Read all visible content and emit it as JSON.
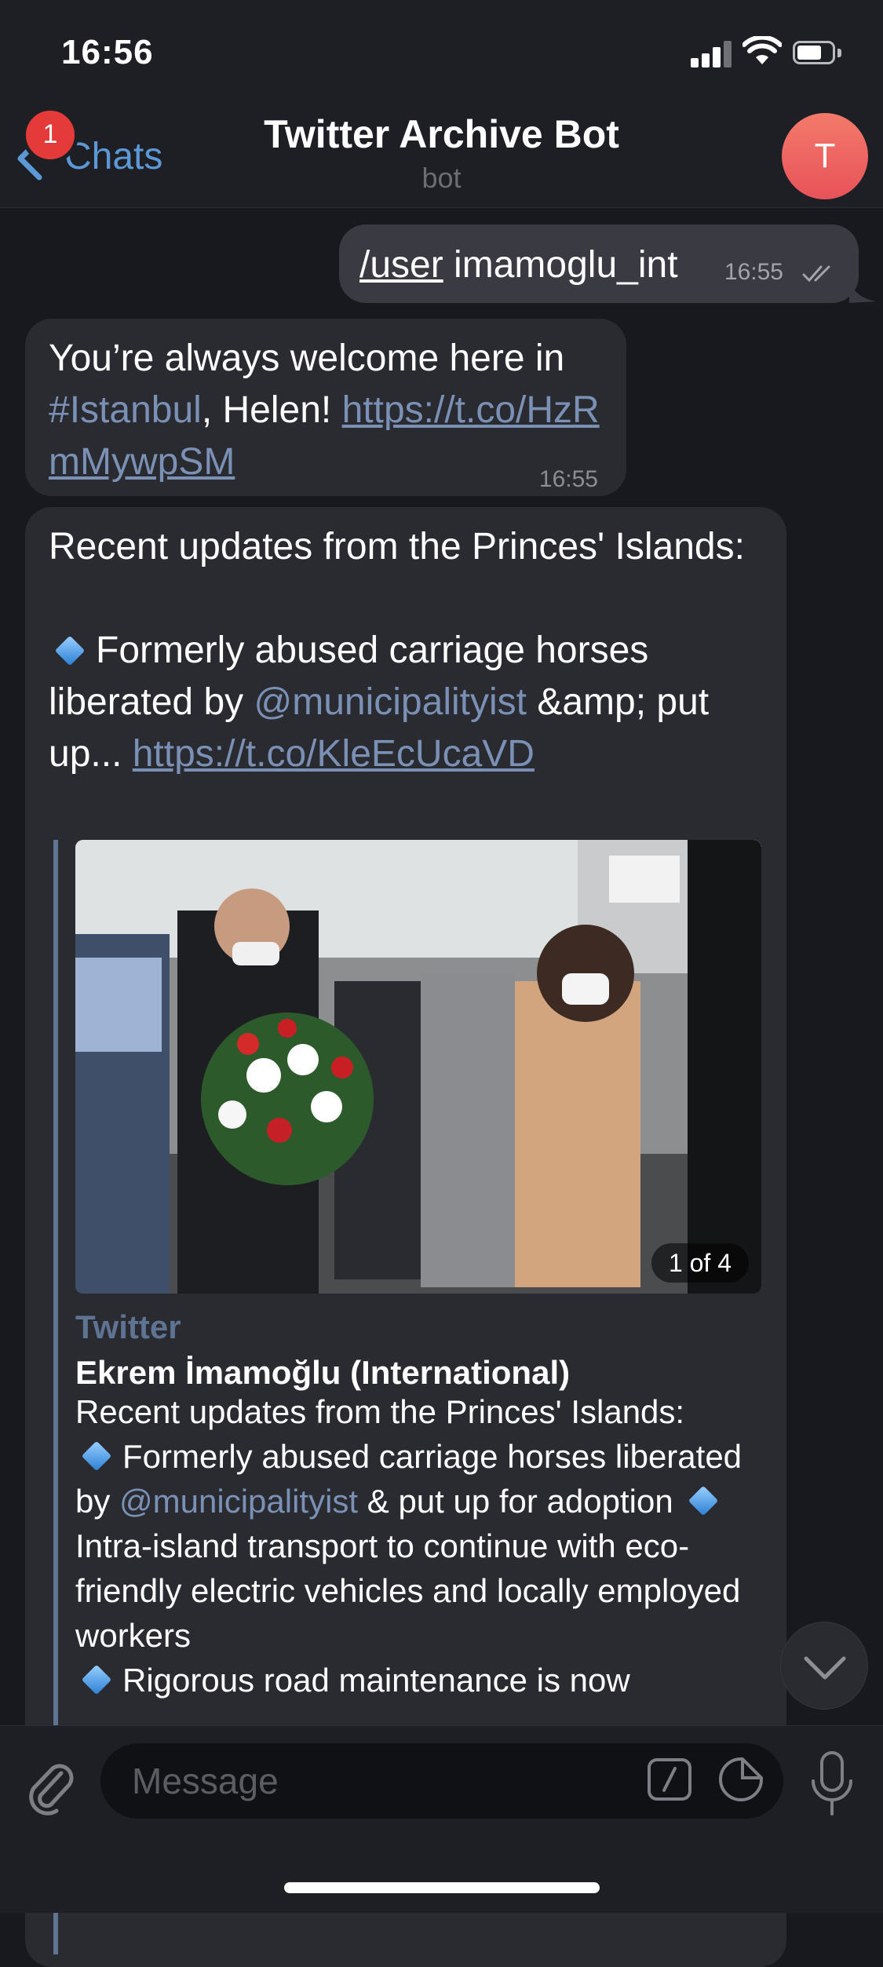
{
  "status_bar": {
    "time": "16:56"
  },
  "header": {
    "back_label": "Chats",
    "unread_badge": "1",
    "title": "Twitter Archive Bot",
    "subtitle": "bot",
    "avatar_letter": "T"
  },
  "messages": {
    "outgoing": {
      "command": "/user",
      "text": " imamoglu_int",
      "time": "16:55"
    },
    "incoming_1": {
      "text_a": "You’re always welcome here in ",
      "hashtag": "#Istanbul",
      "text_b": ", Helen! ",
      "link": "https://t.co/HzRmMywpSM",
      "time": "16:55"
    },
    "incoming_2": {
      "line1": "Recent updates from the Princes' Islands:",
      "bullet_text_a": "Formerly abused carriage horses liberated by ",
      "mention": "@municipalityist",
      "bullet_text_b": " &amp; put up... ",
      "link": "https://t.co/KleEcUcaVD",
      "preview": {
        "photo_counter": "1 of 4",
        "site": "Twitter",
        "title": "Ekrem İmamoğlu (International)",
        "line1": "Recent updates from the Princes' Islands:",
        "b1_a": "Formerly abused carriage horses liberated by ",
        "b1_mention": "@municipalityist",
        "b1_b": " & put up for adoption",
        "b2": "Intra-island transport to continue with eco-friendly electric vehicles and locally employed workers",
        "b3": "Rigorous road maintenance is now"
      }
    }
  },
  "input": {
    "placeholder": "Message"
  },
  "colors": {
    "accent": "#5c98d6",
    "link": "#7a90b5",
    "badge": "#e53a3a",
    "avatar": "#ec6161"
  },
  "icons": [
    "chevron-left-icon",
    "signal-icon",
    "wifi-icon",
    "battery-icon",
    "double-check-icon",
    "attach-icon",
    "bot-command-icon",
    "sticker-icon",
    "microphone-icon",
    "chevron-down-icon"
  ]
}
